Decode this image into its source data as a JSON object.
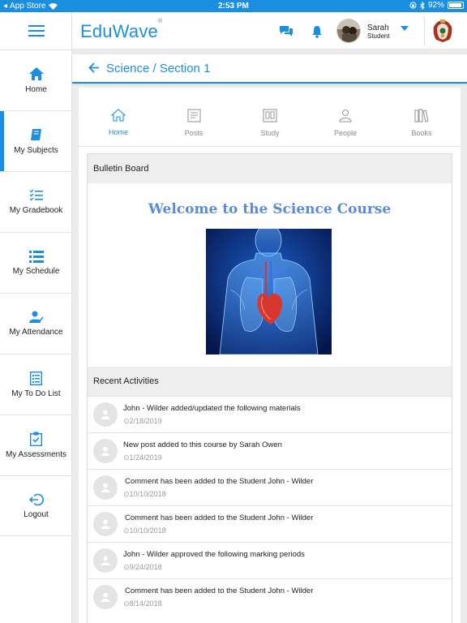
{
  "status_bar": {
    "carrier": "App Store",
    "time": "2:53 PM",
    "battery": "92%"
  },
  "header": {
    "logo_text": "EduWave",
    "logo_mark": "®",
    "user_name": "Sarah",
    "user_role": "Student",
    "brand_color": "#1b8fdf"
  },
  "sidebar": {
    "items": [
      {
        "label": "Home",
        "icon": "home-icon"
      },
      {
        "label": "My Subjects",
        "icon": "book-icon",
        "active": true
      },
      {
        "label": "My Gradebook",
        "icon": "checklist-icon"
      },
      {
        "label": "My Schedule",
        "icon": "list-icon"
      },
      {
        "label": "My Attendance",
        "icon": "user-check-icon"
      },
      {
        "label": "My To Do List",
        "icon": "todo-icon"
      },
      {
        "label": "My Assessments",
        "icon": "clipboard-icon"
      },
      {
        "label": "Logout",
        "icon": "logout-icon"
      }
    ]
  },
  "breadcrumb": {
    "title": "Science / Section 1"
  },
  "tabs": [
    {
      "label": "Home",
      "icon": "home-outline-icon",
      "active": true
    },
    {
      "label": "Posts",
      "icon": "posts-icon"
    },
    {
      "label": "Study",
      "icon": "study-icon"
    },
    {
      "label": "People",
      "icon": "people-icon"
    },
    {
      "label": "Books",
      "icon": "books-icon"
    }
  ],
  "bulletin": {
    "heading": "Bulletin Board",
    "welcome": "Welcome to the Science Course"
  },
  "recent": {
    "heading": "Recent Activities",
    "items": [
      {
        "text": "John  - Wilder added/updated the following materials",
        "date": "2/18/2019"
      },
      {
        "text": "New post added to this course by Sarah  Owen",
        "date": "1/24/2019"
      },
      {
        "text": "Comment has been added to the Student John  - Wilder",
        "date": "10/10/2018"
      },
      {
        "text": "Comment has been added to the Student John  - Wilder",
        "date": "10/10/2018"
      },
      {
        "text": "John  - Wilder approved the following marking periods",
        "date": "9/24/2018"
      },
      {
        "text": "Comment has been added to the Student John  - Wilder",
        "date": "8/14/2018"
      }
    ]
  }
}
